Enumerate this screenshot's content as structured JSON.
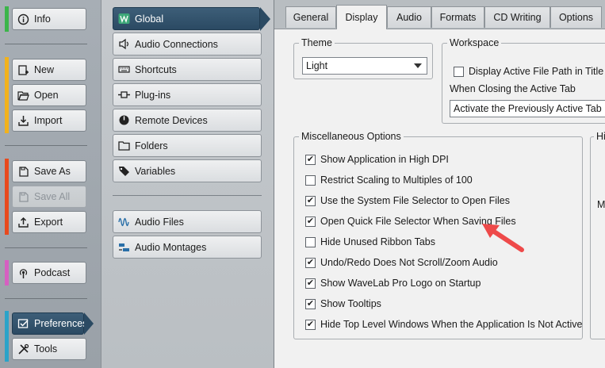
{
  "left_column": {
    "groups": [
      {
        "color": "#3bb54a",
        "items": [
          {
            "label": "Info",
            "icon": "info-icon"
          }
        ]
      },
      {
        "color": "#f2b21b",
        "items": [
          {
            "label": "New",
            "icon": "new-icon"
          },
          {
            "label": "Open",
            "icon": "folder-open-icon"
          },
          {
            "label": "Import",
            "icon": "import-icon"
          }
        ]
      },
      {
        "color": "#e8491d",
        "items": [
          {
            "label": "Save As",
            "icon": "save-as-icon"
          },
          {
            "label": "Save All",
            "icon": "save-all-icon",
            "disabled": true
          },
          {
            "label": "Export",
            "icon": "export-icon"
          }
        ]
      },
      {
        "color": "#d65fc1",
        "items": [
          {
            "label": "Podcast",
            "icon": "podcast-icon"
          }
        ]
      },
      {
        "color": "#2aa3c9",
        "items": [
          {
            "label": "Preferences",
            "icon": "preferences-icon",
            "selected": true
          },
          {
            "label": "Tools",
            "icon": "tools-icon"
          }
        ]
      }
    ]
  },
  "middle_column": {
    "items": [
      {
        "label": "Global",
        "icon": "wavelab-icon",
        "selected": true
      },
      {
        "label": "Audio Connections",
        "icon": "speaker-icon"
      },
      {
        "label": "Shortcuts",
        "icon": "keyboard-icon"
      },
      {
        "label": "Plug-ins",
        "icon": "plugin-icon"
      },
      {
        "label": "Remote Devices",
        "icon": "remote-device-icon"
      },
      {
        "label": "Folders",
        "icon": "folder-icon"
      },
      {
        "label": "Variables",
        "icon": "tag-icon"
      }
    ],
    "items2": [
      {
        "label": "Audio Files",
        "icon": "waveform-icon"
      },
      {
        "label": "Audio Montages",
        "icon": "montage-icon"
      }
    ]
  },
  "tabs": [
    "General",
    "Display",
    "Audio",
    "Formats",
    "CD Writing",
    "Options"
  ],
  "active_tab": "Display",
  "theme": {
    "label": "Theme",
    "value": "Light"
  },
  "workspace": {
    "label": "Workspace",
    "checkbox_label": "Display Active File Path in Title Ba",
    "checked": false,
    "closing_label": "When Closing the Active Tab",
    "closing_value": "Activate the Previously Active Tab"
  },
  "misc": {
    "label": "Miscellaneous Options",
    "options": [
      {
        "label": "Show Application in High DPI",
        "checked": true
      },
      {
        "label": "Restrict Scaling to Multiples of 100",
        "checked": false
      },
      {
        "label": "Use the System File Selector to Open Files",
        "checked": true
      },
      {
        "label": "Open Quick File Selector When Saving Files",
        "checked": true
      },
      {
        "label": "Hide Unused Ribbon Tabs",
        "checked": false
      },
      {
        "label": "Undo/Redo Does Not Scroll/Zoom Audio",
        "checked": true
      },
      {
        "label": "Show WaveLab Pro Logo on Startup",
        "checked": true
      },
      {
        "label": "Show Tooltips",
        "checked": true
      },
      {
        "label": "Hide Top Level Windows When the Application Is Not Active",
        "checked": true
      }
    ]
  },
  "partial": {
    "group_label": "Hi",
    "text": "M"
  },
  "annotation": {
    "color": "#ee4a4a"
  }
}
